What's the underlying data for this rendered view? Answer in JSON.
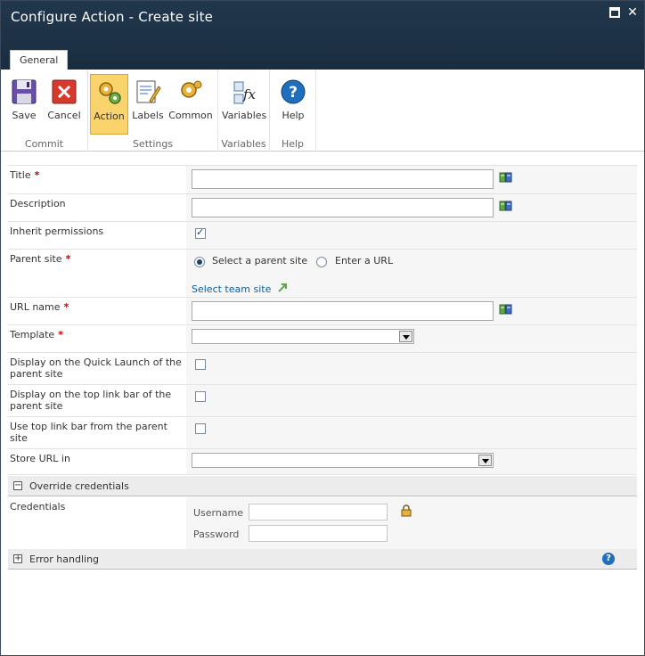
{
  "window": {
    "title": "Configure Action - Create site"
  },
  "ribbon": {
    "tab": "General",
    "groups": {
      "commit": "Commit",
      "settings": "Settings",
      "variables": "Variables",
      "help": "Help"
    },
    "buttons": {
      "save": "Save",
      "cancel": "Cancel",
      "action": "Action",
      "labels": "Labels",
      "common": "Common",
      "variables": "Variables",
      "help": "Help"
    }
  },
  "form": {
    "title": {
      "label": "Title",
      "value": ""
    },
    "description": {
      "label": "Description",
      "value": ""
    },
    "inherit_permissions": {
      "label": "Inherit permissions",
      "checked": true
    },
    "parent_site": {
      "label": "Parent site",
      "option_select": "Select a parent site",
      "option_url": "Enter a URL",
      "selected": "Select a parent site",
      "link": "Select team site"
    },
    "url_name": {
      "label": "URL name",
      "value": ""
    },
    "template": {
      "label": "Template",
      "value": ""
    },
    "quick_launch": {
      "label": "Display on the Quick Launch of the parent site",
      "checked": false
    },
    "top_link_bar": {
      "label": "Display on the top link bar of the parent site",
      "checked": false
    },
    "use_top_link": {
      "label": "Use top link bar from the parent site",
      "checked": false
    },
    "store_url": {
      "label": "Store URL in",
      "value": ""
    }
  },
  "override": {
    "title": "Override credentials",
    "toggle": "−",
    "credentials_label": "Credentials",
    "username_label": "Username",
    "password_label": "Password"
  },
  "error_handling": {
    "title": "Error handling",
    "toggle": "+"
  },
  "required_marker": "*",
  "colors": {
    "title_bar": "#21374c",
    "active_button": "#fbd36d",
    "link": "#0a5f9e",
    "required": "#cc0000"
  }
}
